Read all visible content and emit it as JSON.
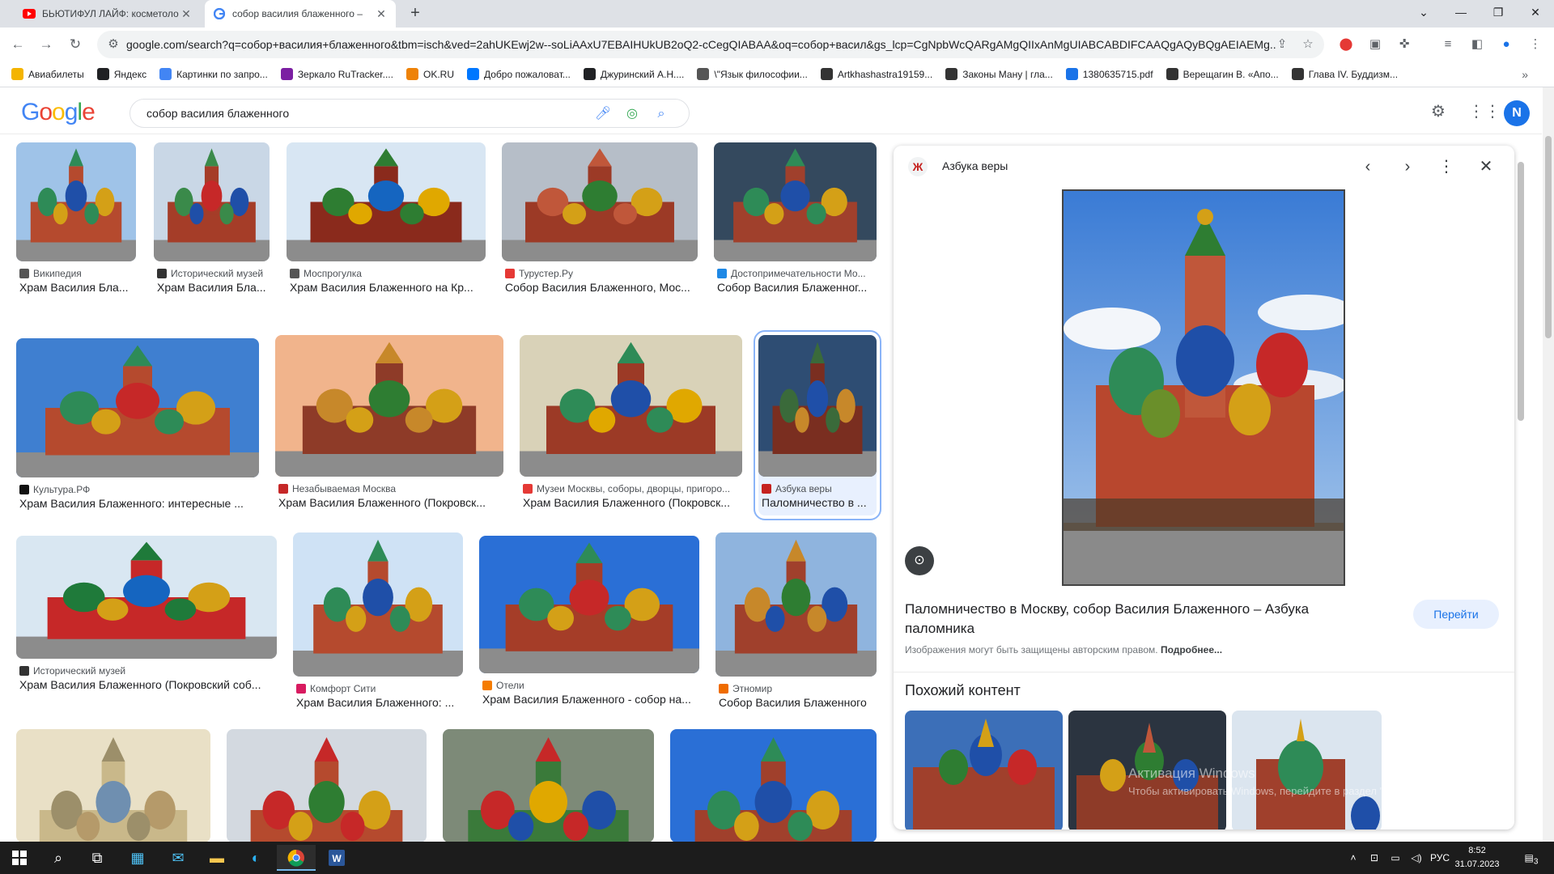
{
  "browser": {
    "tabs": [
      {
        "title": "БЬЮТИФУЛ ЛАЙФ: косметоло",
        "icon": "youtube-icon"
      },
      {
        "title": "собор василия блаженного –",
        "icon": "google-icon"
      }
    ],
    "url": "google.com/search?q=собор+василия+блаженного&tbm=isch&ved=2ahUKEwj2w--soLiAAxU7EBAIHUkUB2oQ2-cCegQIABAA&oq=собор+васил&gs_lcp=CgNpbWcQARgAMgQIIxAnMgUIABCABDIFCAAQgAQyBQgAEIAEMg...",
    "bookmarks": [
      {
        "label": "Авиабилеты",
        "color": "#f4b400"
      },
      {
        "label": "Яндекс",
        "color": "#202124"
      },
      {
        "label": "Картинки по запро...",
        "color": "#4285f4"
      },
      {
        "label": "Зеркало RuTracker....",
        "color": "#7b1fa2"
      },
      {
        "label": "OK.RU",
        "color": "#ee8208"
      },
      {
        "label": "Добро пожаловат...",
        "color": "#0077ff"
      },
      {
        "label": "Джуринский А.Н....",
        "color": "#202124"
      },
      {
        "label": "\\\"Язык философии...",
        "color": "#555555"
      },
      {
        "label": "Artkhashastra19159...",
        "color": "#333333"
      },
      {
        "label": "Законы Ману | гла...",
        "color": "#333333"
      },
      {
        "label": "1380635715.pdf",
        "color": "#1a73e8"
      },
      {
        "label": "Верещагин В. «Апо...",
        "color": "#333333"
      },
      {
        "label": "Глава IV. Буддизм...",
        "color": "#333333"
      }
    ]
  },
  "google": {
    "logo": "Google",
    "query": "собор василия блаженного",
    "avatar_letter": "N"
  },
  "results": [
    {
      "source": "Википедия",
      "title": "Храм Василия Бла...",
      "icon_color": "#555"
    },
    {
      "source": "Исторический музей",
      "title": "Храм Василия Бла...",
      "icon_color": "#333"
    },
    {
      "source": "Моспрогулка",
      "title": "Храм Василия Блаженного на Кр...",
      "icon_color": "#555"
    },
    {
      "source": "Турустер.Ру",
      "title": "Собор Василия Блаженного, Мос...",
      "icon_color": "#e53935"
    },
    {
      "source": "Достопримечательности Мо...",
      "title": "Собор Василия Блаженног...",
      "icon_color": "#1e88e5"
    },
    {
      "source": "Культура.РФ",
      "title": "Храм Василия Блаженного: интересные ...",
      "icon_color": "#111"
    },
    {
      "source": "Незабываемая Москва",
      "title": "Храм Василия Блаженного (Покровск...",
      "icon_color": "#c62828"
    },
    {
      "source": "Музеи Москвы, соборы, дворцы, пригоро...",
      "title": "Храм Василия Блаженного (Покровск...",
      "icon_color": "#e53935"
    },
    {
      "source": "Азбука веры",
      "title": "Паломничество в ...",
      "icon_color": "#c5221f"
    },
    {
      "source": "Исторический музей",
      "title": "Храм Василия Блаженного (Покровский соб...",
      "icon_color": "#333"
    },
    {
      "source": "Комфорт Сити",
      "title": "Храм Василия Блаженного: ...",
      "icon_color": "#d81b60"
    },
    {
      "source": "Отели",
      "title": "Храм Василия Блаженного - собор на...",
      "icon_color": "#f57c00"
    },
    {
      "source": "Этномир",
      "title": "Собор Василия Блаженного",
      "icon_color": "#ef6c00"
    }
  ],
  "panel": {
    "site": "Азбука веры",
    "title": "Паломничество в Москву, собор Василия Блаженного – Азбука паломника",
    "copyright": "Изображения могут быть защищены авторским правом.",
    "more_link": "Подробнее...",
    "go_button": "Перейти",
    "similar_heading": "Похожий контент"
  },
  "watermark": {
    "line1": "Активация Windows",
    "line2": "Чтобы активировать Windows, перейдите в раздел \"Параметры\"."
  },
  "taskbar": {
    "language": "РУС",
    "time": "8:52",
    "date": "31.07.2023",
    "notifications": "3"
  }
}
